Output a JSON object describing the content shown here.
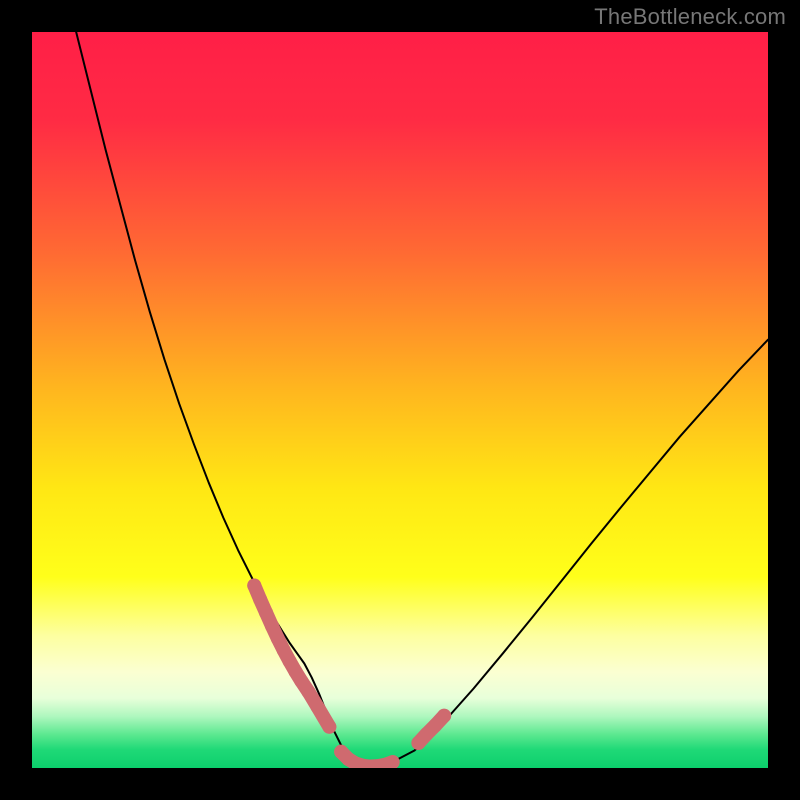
{
  "watermark": "TheBottleneck.com",
  "chart_data": {
    "type": "line",
    "title": "",
    "xlabel": "",
    "ylabel": "",
    "xlim": [
      0,
      100
    ],
    "ylim": [
      0,
      100
    ],
    "gradient_stops": [
      {
        "offset": 0.0,
        "color": "#ff1f47"
      },
      {
        "offset": 0.12,
        "color": "#ff2b44"
      },
      {
        "offset": 0.3,
        "color": "#ff6a33"
      },
      {
        "offset": 0.48,
        "color": "#ffb41f"
      },
      {
        "offset": 0.62,
        "color": "#ffe714"
      },
      {
        "offset": 0.74,
        "color": "#ffff1a"
      },
      {
        "offset": 0.82,
        "color": "#fdffa0"
      },
      {
        "offset": 0.87,
        "color": "#fbffd2"
      },
      {
        "offset": 0.905,
        "color": "#e8ffda"
      },
      {
        "offset": 0.93,
        "color": "#aef7be"
      },
      {
        "offset": 0.955,
        "color": "#5ae88f"
      },
      {
        "offset": 0.975,
        "color": "#1fd977"
      },
      {
        "offset": 1.0,
        "color": "#0ccf6c"
      }
    ],
    "series": [
      {
        "name": "bottleneck-curve",
        "stroke": "#000000",
        "stroke_width": 2,
        "x": [
          6,
          8,
          10,
          12,
          14,
          16,
          18,
          20,
          22,
          24,
          26,
          28,
          30,
          31,
          32,
          33,
          34,
          35,
          36,
          37,
          38,
          39,
          40,
          41,
          42,
          44,
          46,
          48,
          52,
          56,
          60,
          64,
          68,
          72,
          76,
          80,
          84,
          88,
          92,
          96,
          100
        ],
        "y": [
          100,
          92,
          84,
          76.5,
          69,
          62,
          55.5,
          49.5,
          44,
          38.8,
          34,
          29.6,
          25.6,
          23.7,
          21.9,
          20.2,
          18.6,
          17,
          15.6,
          14.2,
          12.3,
          10.1,
          7.6,
          5.1,
          3.1,
          0.8,
          0.1,
          0.3,
          2.4,
          6.3,
          10.8,
          15.6,
          20.5,
          25.5,
          30.5,
          35.4,
          40.2,
          45,
          49.5,
          54,
          58.2
        ]
      },
      {
        "name": "marker-band-left",
        "type": "scatter",
        "stroke": "#cf6a6f",
        "stroke_width": 14,
        "x": [
          30.2,
          31.0,
          31.8,
          32.6,
          33.4,
          34.2,
          35.0,
          35.8,
          36.6,
          37.6,
          38.8,
          40.4
        ],
        "y": [
          24.8,
          22.9,
          21.1,
          19.3,
          17.6,
          16.0,
          14.5,
          13.1,
          11.8,
          10.3,
          8.3,
          5.6
        ]
      },
      {
        "name": "marker-band-bottom",
        "type": "scatter",
        "stroke": "#cf6a6f",
        "stroke_width": 14,
        "x": [
          42.0,
          43.0,
          44.0,
          45.0,
          46.0,
          47.0,
          48.0,
          49.0
        ],
        "y": [
          2.2,
          1.2,
          0.6,
          0.3,
          0.2,
          0.25,
          0.45,
          0.8
        ]
      },
      {
        "name": "marker-band-right",
        "type": "scatter",
        "stroke": "#cf6a6f",
        "stroke_width": 14,
        "x": [
          52.5,
          53.6,
          54.8,
          56.0
        ],
        "y": [
          3.4,
          4.6,
          5.8,
          7.1
        ]
      }
    ]
  }
}
